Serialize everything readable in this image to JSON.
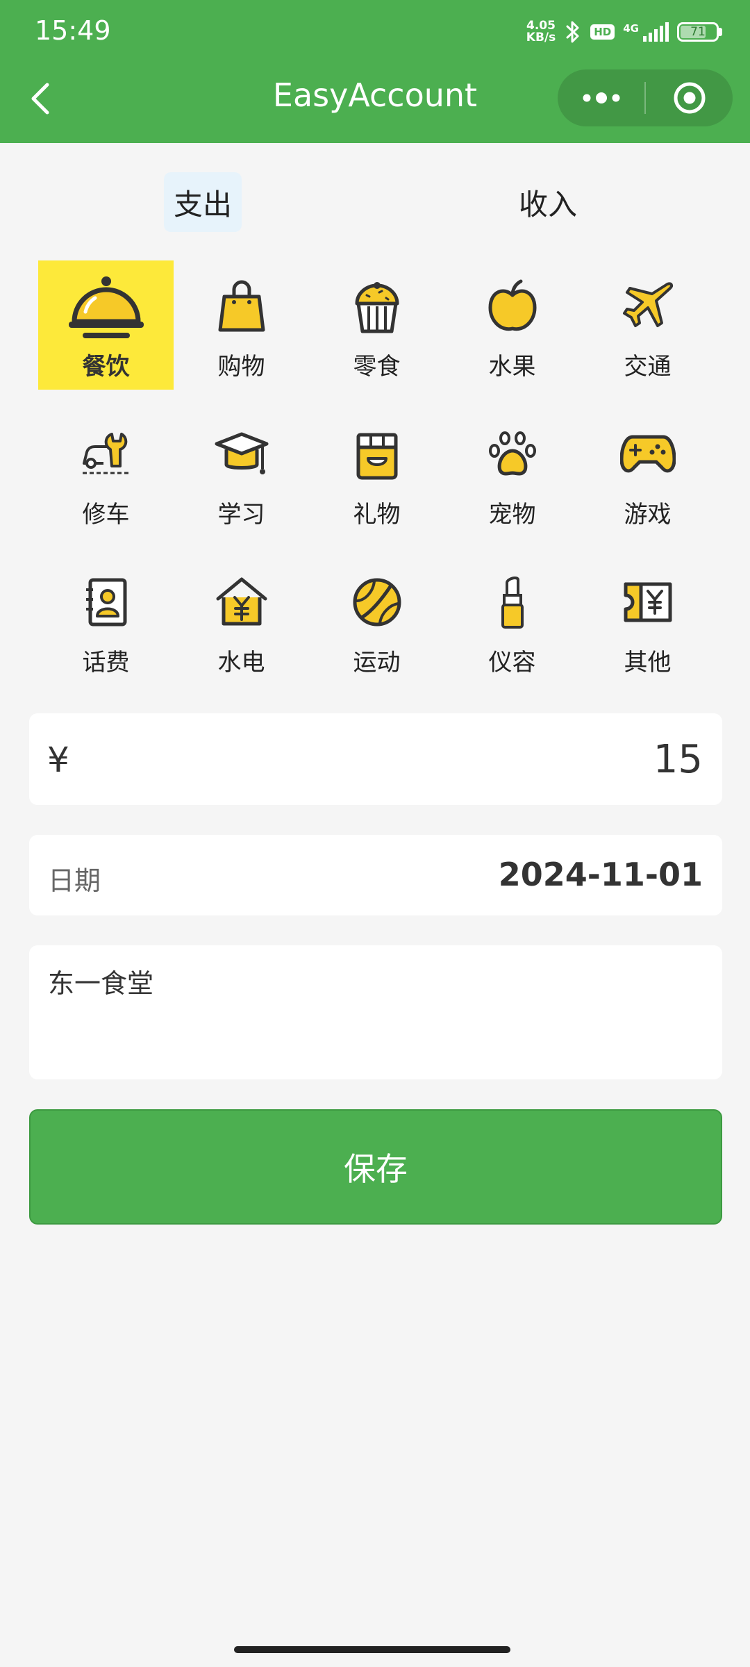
{
  "status_bar": {
    "time": "15:49",
    "net_speed_value": "4.05",
    "net_speed_unit": "KB/s",
    "hd": "HD",
    "network": "4G",
    "battery": "71",
    "battery_level": 0.71
  },
  "nav": {
    "title": "EasyAccount"
  },
  "tabs": [
    {
      "label": "支出",
      "active": true
    },
    {
      "label": "收入",
      "active": false
    }
  ],
  "categories": [
    {
      "label": "餐饮",
      "icon": "cloche-icon",
      "selected": true
    },
    {
      "label": "购物",
      "icon": "shopping-bag-icon",
      "selected": false
    },
    {
      "label": "零食",
      "icon": "cupcake-icon",
      "selected": false
    },
    {
      "label": "水果",
      "icon": "apple-icon",
      "selected": false
    },
    {
      "label": "交通",
      "icon": "airplane-icon",
      "selected": false
    },
    {
      "label": "修车",
      "icon": "car-wrench-icon",
      "selected": false
    },
    {
      "label": "学习",
      "icon": "graduation-cap-icon",
      "selected": false
    },
    {
      "label": "礼物",
      "icon": "gift-box-icon",
      "selected": false
    },
    {
      "label": "宠物",
      "icon": "paw-icon",
      "selected": false
    },
    {
      "label": "游戏",
      "icon": "gamepad-icon",
      "selected": false
    },
    {
      "label": "话费",
      "icon": "contact-book-icon",
      "selected": false
    },
    {
      "label": "水电",
      "icon": "house-yuan-icon",
      "selected": false
    },
    {
      "label": "运动",
      "icon": "ball-icon",
      "selected": false
    },
    {
      "label": "仪容",
      "icon": "lipstick-icon",
      "selected": false
    },
    {
      "label": "其他",
      "icon": "ticket-yuan-icon",
      "selected": false
    }
  ],
  "form": {
    "currency": "¥",
    "amount": "15",
    "date_label": "日期",
    "date_value": "2024-11-01",
    "note": "东一食堂"
  },
  "save_label": "保存",
  "colors": {
    "primary": "#4caf50",
    "selected_category": "#fde93a",
    "icon_fill": "#f6c928",
    "icon_stroke": "#333333"
  }
}
